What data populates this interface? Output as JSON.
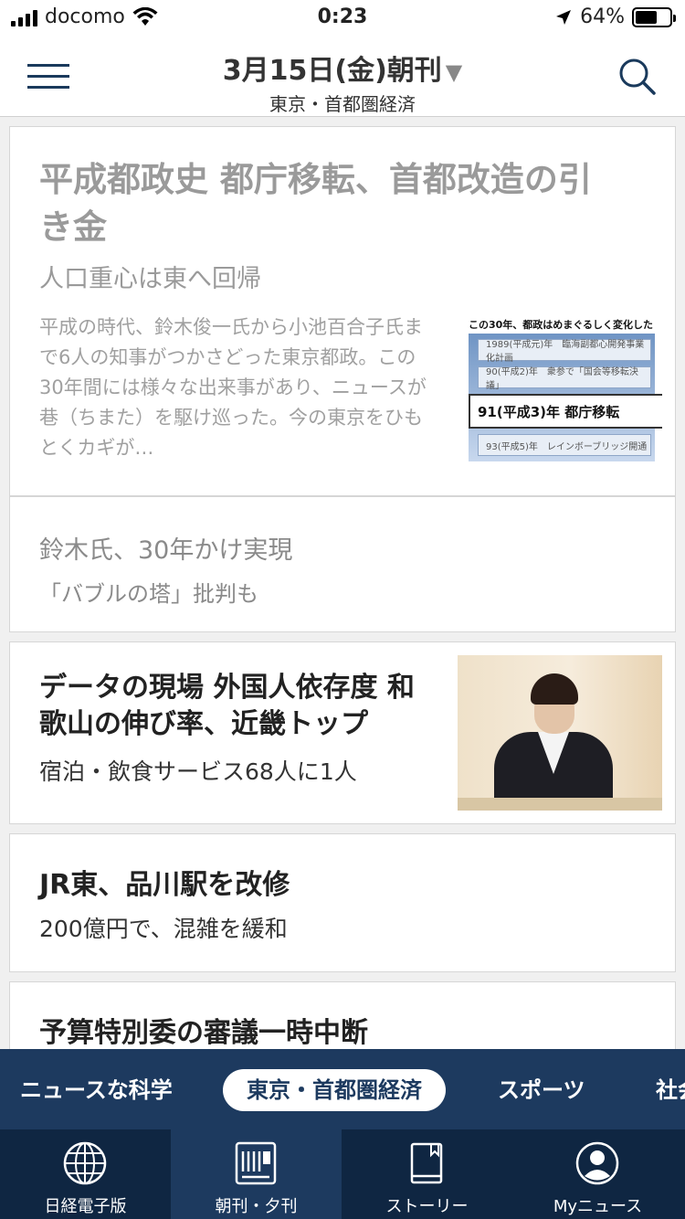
{
  "status": {
    "carrier": "docomo",
    "time": "0:23",
    "battery": "64%",
    "battery_level": 0.64
  },
  "nav": {
    "date": "3月15日(金)朝刊",
    "dropdown_arrow": "▼",
    "section": "東京・首都圏経済",
    "menu_icon": "hamburger-icon",
    "search_icon": "search-icon"
  },
  "articles": [
    {
      "title": "平成都政史 都庁移転、首都改造の引き金",
      "subtitle": "人口重心は東へ回帰",
      "summary": "平成の時代、鈴木俊一氏から小池百合子氏まで6人の知事がつかさどった東京都政。この30年間には様々な出来事があり、ニュースが巷（ちまた）を駆け巡った。今の東京をひもとくカギが…",
      "thumb": {
        "caption": "この30年、都政はめまぐるしく変化した",
        "rows": [
          "1989(平成元)年　臨海副都心開発事業化計画",
          "90(平成2)年　衆参で「国会等移転決議」",
          "91(平成3)年 都庁移転",
          "93(平成5)年　レインボーブリッジ開通"
        ]
      }
    },
    {
      "related_1": "鈴木氏、30年かけ実現",
      "related_2": "「バブルの塔」批判も"
    },
    {
      "title": "データの現場 外国人依存度 和歌山の伸び率、近畿トップ",
      "subtitle": "宿泊・飲食サービス68人に1人"
    },
    {
      "title": "JR東、品川駅を改修",
      "subtitle": "200億円で、混雑を緩和"
    },
    {
      "title": "予算特別委の審議一時中断"
    }
  ],
  "categories": [
    "ニュースな科学",
    "東京・首都圏経済",
    "スポーツ",
    "社会"
  ],
  "active_category": "東京・首都圏経済",
  "tabs": [
    {
      "label": "日経電子版",
      "icon": "globe-icon"
    },
    {
      "label": "朝刊・夕刊",
      "icon": "newspaper-icon"
    },
    {
      "label": "ストーリー",
      "icon": "book-icon"
    },
    {
      "label": "Myニュース",
      "icon": "person-icon"
    }
  ],
  "active_tab": "朝刊・夕刊",
  "colors": {
    "navy": "#1d3a5f",
    "navy_dark": "#0f2642",
    "faded_text": "#9a9a9a"
  }
}
